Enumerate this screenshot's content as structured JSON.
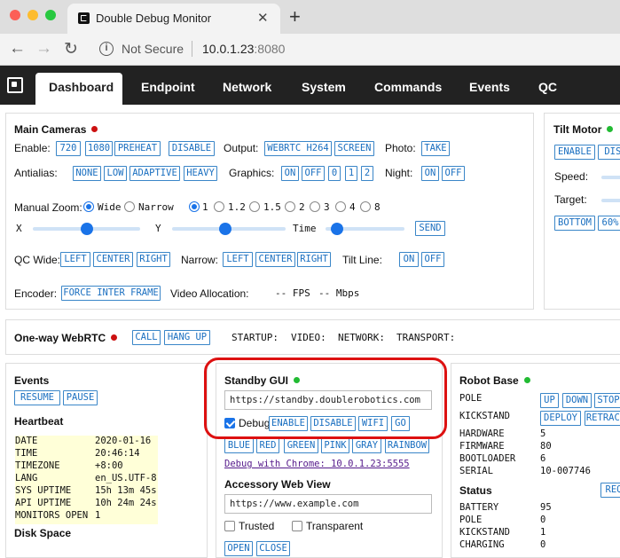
{
  "browser": {
    "tab_title": "Double Debug Monitor",
    "new_tab": "+",
    "close": "✕",
    "security": "Not Secure",
    "url_host": "10.0.1.23",
    "url_port": ":8080"
  },
  "nav": {
    "items": [
      "Dashboard",
      "Endpoint",
      "Network",
      "System",
      "Commands",
      "Events",
      "QC"
    ],
    "active": "Dashboard"
  },
  "colors": {
    "status_red": "#cc1111",
    "status_green": "#22bb33",
    "accent": "#1a73e8",
    "highlight": "#dd1111"
  },
  "main_cameras": {
    "title": "Main Cameras",
    "enable_label": "Enable:",
    "enable_buttons": [
      "720",
      "1080",
      "PREHEAT",
      "DISABLE"
    ],
    "output_label": "Output:",
    "output_buttons": [
      "WEBRTC H264",
      "SCREEN"
    ],
    "photo_label": "Photo:",
    "photo_buttons": [
      "TAKE"
    ],
    "antialias_label": "Antialias:",
    "antialias_buttons": [
      "NONE",
      "LOW",
      "ADAPTIVE",
      "HEAVY"
    ],
    "graphics_label": "Graphics:",
    "graphics_buttons": [
      "ON",
      "OFF",
      "0",
      "1",
      "2"
    ],
    "night_label": "Night:",
    "night_buttons": [
      "ON",
      "OFF"
    ],
    "manual_zoom_label": "Manual Zoom:",
    "zoom_modes": [
      "Wide",
      "Narrow"
    ],
    "zoom_levels": [
      "1",
      "1.2",
      "1.5",
      "2",
      "3",
      "4",
      "8"
    ],
    "slider_x": "X",
    "slider_y": "Y",
    "slider_time": "Time",
    "send": "SEND",
    "qc_wide_label": "QC Wide:",
    "qc_wide_buttons": [
      "LEFT",
      "CENTER",
      "RIGHT"
    ],
    "narrow_label": "Narrow:",
    "narrow_buttons": [
      "LEFT",
      "CENTER",
      "RIGHT"
    ],
    "tilt_line_label": "Tilt Line:",
    "tilt_line_buttons": [
      "ON",
      "OFF"
    ],
    "encoder_label": "Encoder:",
    "encoder_button": "FORCE INTER FRAME",
    "video_alloc_label": "Video Allocation:",
    "fps": "-- FPS",
    "mbps": "-- Mbps"
  },
  "tilt_motor": {
    "title": "Tilt Motor",
    "buttons": [
      "ENABLE",
      "DISA"
    ],
    "speed_label": "Speed:",
    "target_label": "Target:",
    "bottom_buttons": [
      "BOTTOM",
      "60%"
    ]
  },
  "webrtc": {
    "title": "One-way WebRTC",
    "buttons": [
      "CALL",
      "HANG UP"
    ],
    "statuses": [
      "STARTUP:",
      "VIDEO:",
      "NETWORK:",
      "TRANSPORT:"
    ]
  },
  "events": {
    "title": "Events",
    "buttons": [
      "RESUME",
      "PAUSE"
    ],
    "heartbeat_title": "Heartbeat",
    "heartbeat": [
      [
        "DATE",
        "2020-01-16"
      ],
      [
        "TIME",
        "20:46:14"
      ],
      [
        "TIMEZONE",
        "+8:00"
      ],
      [
        "LANG",
        "en_US.UTF-8"
      ],
      [
        "SYS UPTIME",
        "15h 13m 45s"
      ],
      [
        "API UPTIME",
        "10h 24m 24s"
      ],
      [
        "MONITORS OPEN",
        "1"
      ]
    ],
    "disk_space_title": "Disk Space"
  },
  "standby": {
    "title": "Standby GUI",
    "url": "https://standby.doublerobotics.com",
    "debug_label": "Debug",
    "debug_buttons": [
      "ENABLE",
      "DISABLE",
      "WIFI",
      "GO"
    ],
    "color_buttons": [
      "BLUE",
      "RED",
      "GREEN",
      "PINK",
      "GRAY",
      "RAINBOW"
    ],
    "debug_chrome_link": "Debug with Chrome: 10.0.1.23:5555",
    "accessory_title": "Accessory Web View",
    "accessory_url": "https://www.example.com",
    "trusted_label": "Trusted",
    "transparent_label": "Transparent",
    "partial_buttons": [
      "OPEN",
      "CLOSE"
    ]
  },
  "robot_base": {
    "title": "Robot Base",
    "pole_label": "POLE",
    "pole_buttons": [
      "UP",
      "DOWN",
      "STOP"
    ],
    "kickstand_label": "KICKSTAND",
    "kickstand_buttons": [
      "DEPLOY",
      "RETRACT"
    ],
    "info": [
      [
        "HARDWARE",
        "5"
      ],
      [
        "FIRMWARE",
        "80"
      ],
      [
        "BOOTLOADER",
        "6"
      ],
      [
        "SERIAL",
        "10-007746"
      ]
    ],
    "status_title": "Status",
    "status_button": "REQ",
    "status": [
      [
        "BATTERY",
        "95"
      ],
      [
        "POLE",
        "0"
      ],
      [
        "KICKSTAND",
        "1"
      ],
      [
        "CHARGING",
        "0"
      ]
    ]
  }
}
